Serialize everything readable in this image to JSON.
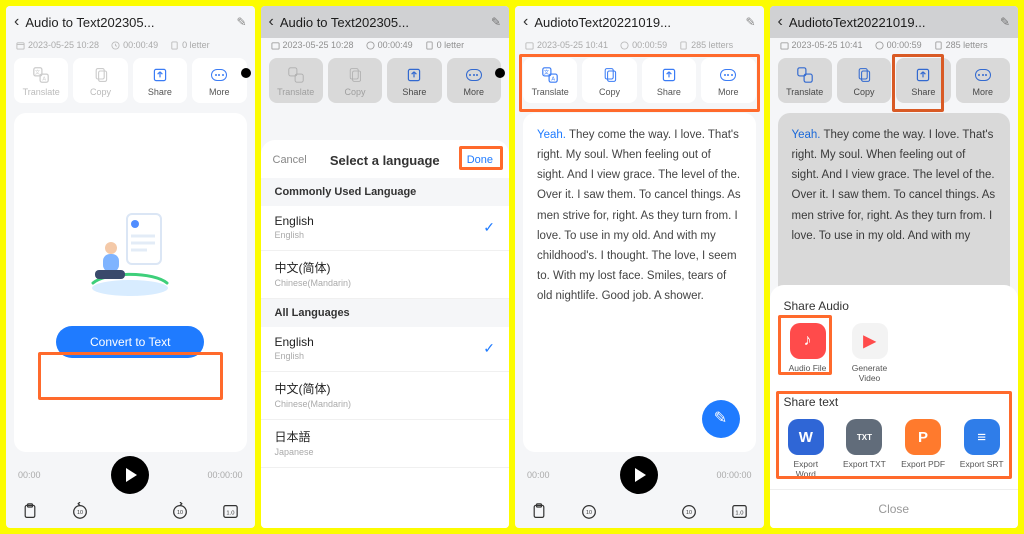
{
  "colors": {
    "accent": "#1f7bff",
    "highlight": "#ff6a2c"
  },
  "actions": {
    "translate": "Translate",
    "copy": "Copy",
    "share": "Share",
    "more": "More"
  },
  "player": {
    "start": "00:00",
    "end": "00:00:00"
  },
  "p1": {
    "title": "Audio to Text202305...",
    "date": "2023-05-25 10:28",
    "duration": "00:00:49",
    "letters": "0 letter",
    "convert": "Convert to Text"
  },
  "p2": {
    "title": "Audio to Text202305...",
    "date": "2023-05-25 10:28",
    "duration": "00:00:49",
    "letters": "0 letter",
    "sheet": {
      "cancel": "Cancel",
      "title": "Select a language",
      "done": "Done",
      "commonly": "Commonly Used Language",
      "all": "All Languages",
      "langs": [
        {
          "native": "English",
          "eng": "English",
          "checked": true
        },
        {
          "native": "中文(简体)",
          "eng": "Chinese(Mandarin)",
          "checked": false
        }
      ],
      "all_langs": [
        {
          "native": "English",
          "eng": "English",
          "checked": true
        },
        {
          "native": "中文(简体)",
          "eng": "Chinese(Mandarin)",
          "checked": false
        },
        {
          "native": "日本語",
          "eng": "Japanese",
          "checked": false
        }
      ]
    }
  },
  "p3": {
    "title": "AudiotoText20221019...",
    "date": "2023-05-25 10:41",
    "duration": "00:00:59",
    "letters": "285 letters",
    "first": "Yeah.",
    "text": " They come the way. I love. That's right. My soul. When feeling out of sight. And I view grace. The level of the. Over it. I saw them. To cancel things. As men strive for, right. As they turn from. I love. To use in my old. And with my childhood's. I thought. The love, I seem to. With my lost face. Smiles, tears of old nightlife. Good job. A shower."
  },
  "p4": {
    "title": "AudiotoText20221019...",
    "date": "2023-05-25 10:41",
    "duration": "00:00:59",
    "letters": "285 letters",
    "first": "Yeah.",
    "text": " They come the way. I love. That's right. My soul. When feeling out of sight. And I view grace. The level of the. Over it. I saw them. To cancel things. As men strive for, right. As they turn from. I love. To use in my old. And with my",
    "share": {
      "audio_title": "Share Audio",
      "text_title": "Share text",
      "audio_items": [
        {
          "label": "Audio File",
          "icon": "audio-file",
          "bg": "#ff4b4b",
          "fg": "#fff"
        },
        {
          "label": "Generate Video",
          "icon": "video",
          "bg": "#f3f3f3",
          "fg": "#ff4b4b"
        }
      ],
      "text_items": [
        {
          "label": "Export Word",
          "icon": "W",
          "bg": "#2f66d6",
          "fg": "#fff"
        },
        {
          "label": "Export TXT",
          "icon": "TXT",
          "bg": "#616c7a",
          "fg": "#fff"
        },
        {
          "label": "Export PDF",
          "icon": "P",
          "bg": "#ff7a2d",
          "fg": "#fff"
        },
        {
          "label": "Export SRT",
          "icon": "≡",
          "bg": "#2f7de9",
          "fg": "#fff"
        }
      ],
      "close": "Close"
    }
  }
}
